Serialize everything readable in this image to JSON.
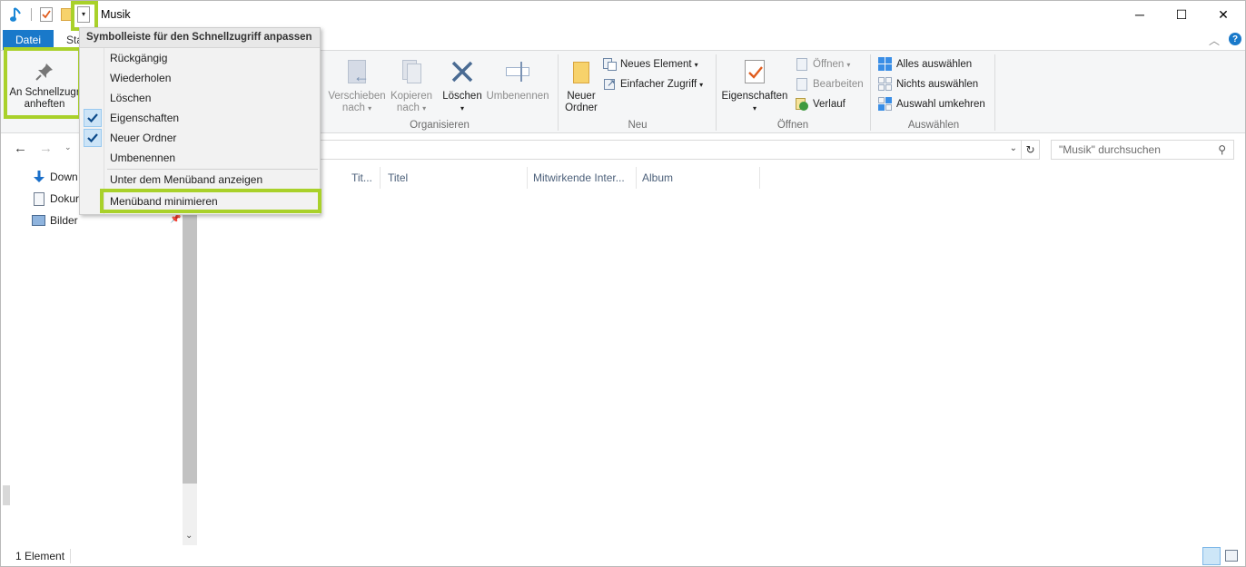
{
  "window": {
    "title": "Musik",
    "controls": {
      "minimize": "─",
      "maximize": "☐",
      "close": "✕"
    }
  },
  "tabs": {
    "file": "Datei",
    "start": "Sta"
  },
  "ribbon": {
    "pin_label_1": "An Schnellzugr",
    "pin_label_2": "anheften",
    "organize": {
      "move_1": "Verschieben",
      "move_2": "nach",
      "copy_1": "Kopieren",
      "copy_2": "nach",
      "delete": "Löschen",
      "rename": "Umbenennen",
      "label": "Organisieren"
    },
    "new": {
      "folder_1": "Neuer",
      "folder_2": "Ordner",
      "new_item": "Neues Element",
      "easy_access": "Einfacher Zugriff",
      "label": "Neu"
    },
    "open": {
      "properties": "Eigenschaften",
      "open": "Öffnen",
      "edit": "Bearbeiten",
      "history": "Verlauf",
      "label": "Öffnen"
    },
    "select": {
      "select_all": "Alles auswählen",
      "select_none": "Nichts auswählen",
      "invert": "Auswahl umkehren",
      "label": "Auswählen"
    }
  },
  "search": {
    "placeholder": "\"Musik\" durchsuchen"
  },
  "nav": {
    "items": [
      {
        "label": "Down"
      },
      {
        "label": "Dokur"
      },
      {
        "label": "Bilder"
      }
    ]
  },
  "columns": [
    "Tit...",
    "Titel",
    "Mitwirkende Inter...",
    "Album"
  ],
  "status": {
    "count": "1 Element"
  },
  "qat_menu": {
    "header": "Symbolleiste für den Schnellzugriff anpassen",
    "items": [
      {
        "label": "Rückgängig",
        "checked": false
      },
      {
        "label": "Wiederholen",
        "checked": false
      },
      {
        "label": "Löschen",
        "checked": false
      },
      {
        "label": "Eigenschaften",
        "checked": true
      },
      {
        "label": "Neuer Ordner",
        "checked": true
      },
      {
        "label": "Umbenennen",
        "checked": false
      }
    ],
    "show_below": "Unter dem Menüband anzeigen",
    "minimize": "Menüband minimieren"
  },
  "colors": {
    "accent": "#1979ca",
    "highlight": "#a9d12a",
    "check": "#0c4a8a"
  }
}
